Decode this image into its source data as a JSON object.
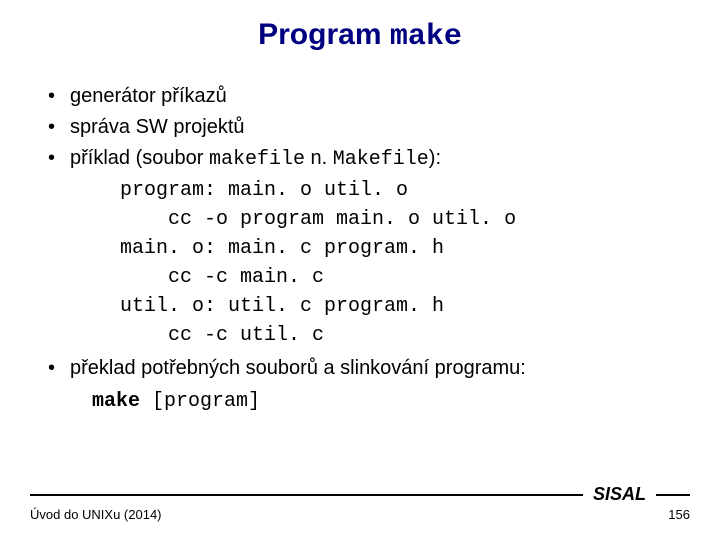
{
  "title": {
    "prefix": "Program ",
    "cmd": "make"
  },
  "bullets": {
    "b1": "generátor příkazů",
    "b2": "správa SW projektů",
    "b3": {
      "p1": "příklad (soubor ",
      "m1": "makefile",
      "p2": " n. ",
      "m2": "Makefile",
      "p3": "):"
    },
    "code": "program: main. o util. o\n    cc -o program main. o util. o\nmain. o: main. c program. h\n    cc -c main. c\nutil. o: util. c program. h\n    cc -c util. c",
    "b4": "překlad potřebných souborů a slinkování programu:",
    "cmd": {
      "bold": "make ",
      "opt": "[program]"
    }
  },
  "footer": {
    "sisal": "SISAL",
    "left": "Úvod do UNIXu (2014)",
    "page": "156"
  }
}
